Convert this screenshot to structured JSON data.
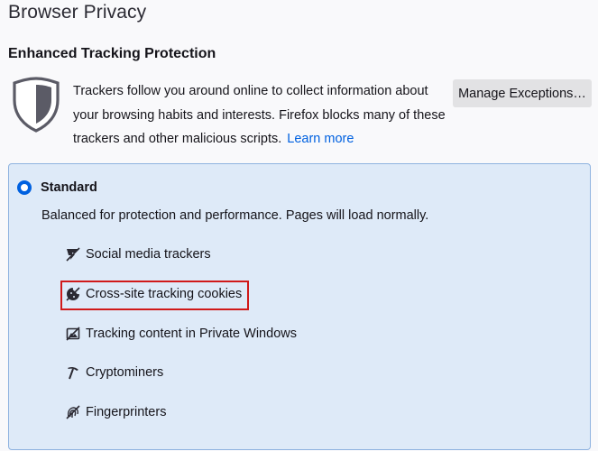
{
  "page": {
    "title": "Browser Privacy"
  },
  "etp": {
    "heading": "Enhanced Tracking Protection",
    "description": "Trackers follow you around online to collect information about your browsing habits and interests. Firefox blocks many of these trackers and other malicious scripts.",
    "learn_more": "Learn more",
    "manage_exceptions": "Manage Exceptions…",
    "shield_icon": "shield-icon"
  },
  "standard": {
    "label": "Standard",
    "selected": true,
    "description": "Balanced for protection and performance. Pages will load normally.",
    "items": [
      {
        "label": "Social media trackers",
        "icon": "social-tracker-icon"
      },
      {
        "label": "Cross-site tracking cookies",
        "icon": "cookie-icon"
      },
      {
        "label": "Tracking content in Private Windows",
        "icon": "tracking-content-icon"
      },
      {
        "label": "Cryptominers",
        "icon": "cryptominer-icon"
      },
      {
        "label": "Fingerprinters",
        "icon": "fingerprint-icon"
      }
    ]
  },
  "colors": {
    "accent": "#0061e0",
    "card_background": "#deeaf8",
    "highlight": "#d01a1a"
  }
}
